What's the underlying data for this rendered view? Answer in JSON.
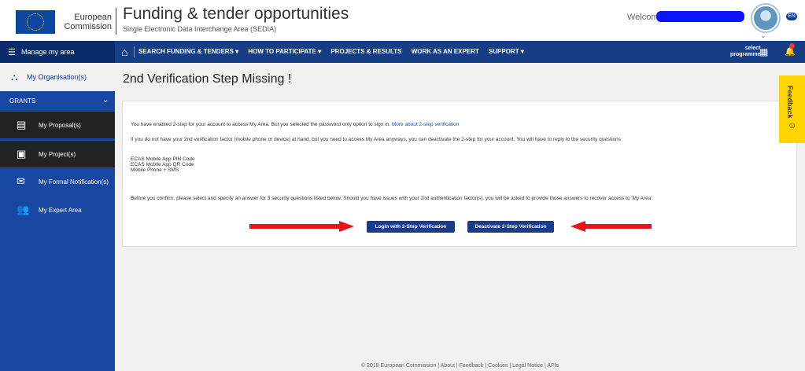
{
  "header": {
    "org_name_line1": "European",
    "org_name_line2": "Commission",
    "site_title": "Funding & tender opportunities",
    "site_subtitle": "Single Electronic Data Interchange Area (SEDIA)",
    "welcome": "Welcome",
    "chip": "EN"
  },
  "navbar": {
    "manage_label": "Manage my area",
    "items": [
      "SEARCH FUNDING & TENDERS ▾",
      "HOW TO PARTICIPATE ▾",
      "PROJECTS & RESULTS",
      "WORK AS AN EXPERT",
      "SUPPORT ▾"
    ],
    "select_programme_line1": "select",
    "select_programme_line2": "programme"
  },
  "sidebar": {
    "organisation": "My Organisation(s)",
    "section": "GRANTS",
    "items": [
      {
        "label": "My Proposal(s)",
        "icon": "proposal-icon"
      },
      {
        "label": "My Project(s)",
        "icon": "project-icon"
      },
      {
        "label": "My Formal Notification(s)",
        "icon": "notification-icon"
      },
      {
        "label": "My Expert Area",
        "icon": "expert-icon"
      }
    ]
  },
  "main": {
    "title": "2nd Verification Step Missing !",
    "para1": "You have enabled 2-step for your account to access My Area. But you selected the password only option to sign in.",
    "para1_link": "More about 2-step verification",
    "para2": "If you do not have your 2nd verification factor (mobile phone or device) at hand, but you need to access My Area anyways, you can deactivate the 2-step for your account. You will have to reply to the security questions",
    "methods": [
      "ECAS Mobile App PIN Code",
      "ECAS Mobile App QR Code",
      "Mobile Phone + SMS"
    ],
    "para3": "Before you confirm, please select and specify an answer for 3 security questions listed below. Should you have issues with your 2nd authentication factor(s), you will be asked to provide those answers to recover access to 'My Area'",
    "btn_login": "Login with 2-Step Verification",
    "btn_deactivate": "Deactivate 2-Step Verification"
  },
  "feedback_tab": "Feedback",
  "footer": "© 2018 European Commission  |  About  |  Feedback  |  Cookies  |  Legal Notice  |  APIs",
  "colors": {
    "nav_blue": "#163e85",
    "sidebar_blue": "#1847a2",
    "button_blue": "#1a3b8c",
    "feedback_yellow": "#ffd400",
    "arrow_red": "#e8141b"
  }
}
